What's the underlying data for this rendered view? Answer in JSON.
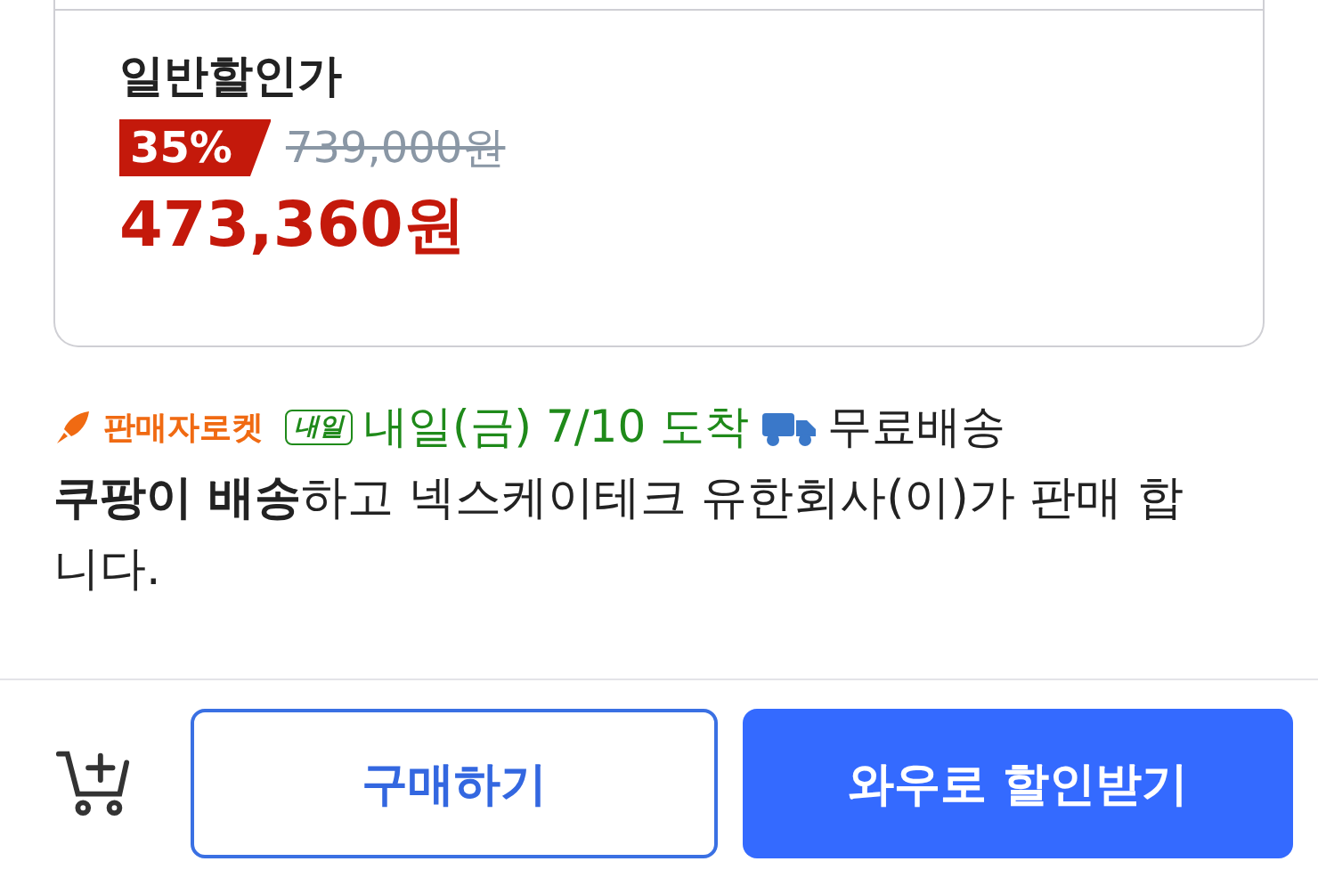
{
  "price_card": {
    "label": "일반할인가",
    "discount": "35%",
    "original_price": "739,000원",
    "sale_price": "473,360원"
  },
  "delivery": {
    "badge": "판매자로켓",
    "tag": "내일",
    "arrival": "내일(금) 7/10 도착",
    "shipping": "무료배송"
  },
  "seller_note": "**쿠팡이 배송**하고 넥스케이테크 유한회사(이)가 판매 합니다.",
  "buttons": [
    {
      "label": "구매하기",
      "kind": "outline"
    },
    {
      "label": "와우로 할인받기",
      "kind": "primary"
    }
  ]
}
